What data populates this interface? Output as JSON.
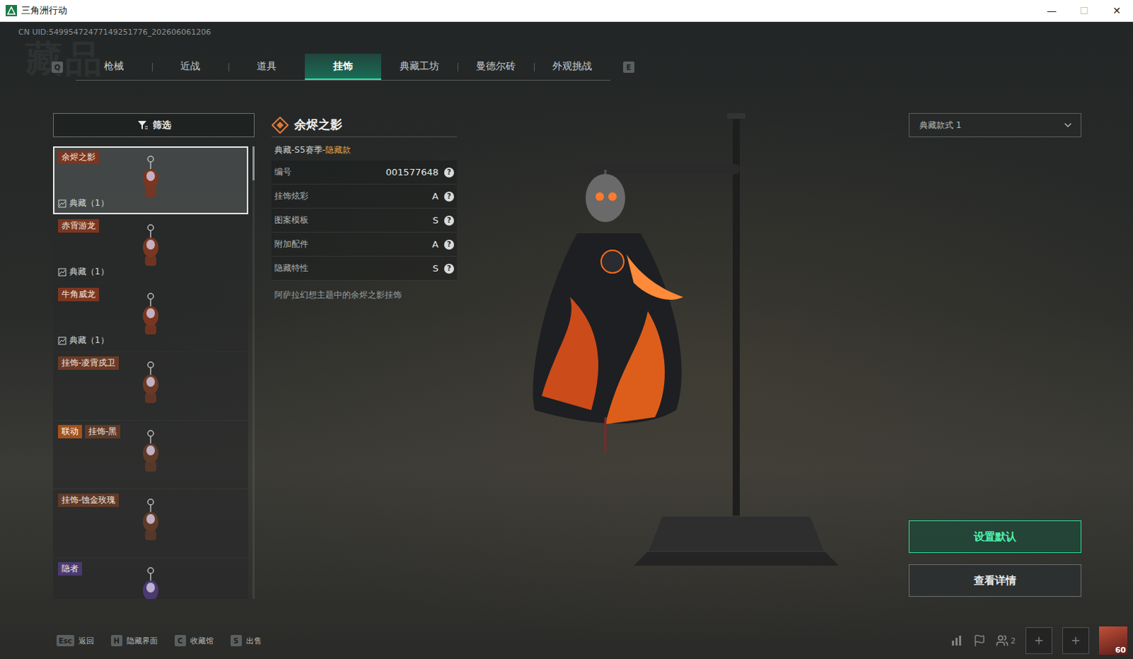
{
  "window": {
    "title": "三角洲行动",
    "controls": [
      "—",
      "☐",
      "✕"
    ]
  },
  "uid": "CN UID:54995472477149251776_202606061206",
  "watermark": "藏品",
  "tabs": {
    "prevKey": "Q",
    "nextKey": "E",
    "items": [
      {
        "label": "枪械",
        "selected": false
      },
      {
        "label": "近战",
        "selected": false
      },
      {
        "label": "道具",
        "selected": false
      },
      {
        "label": "挂饰",
        "selected": true
      },
      {
        "label": "典藏工坊",
        "selected": false
      },
      {
        "label": "曼德尔砖",
        "selected": false
      },
      {
        "label": "外观挑战",
        "selected": false
      }
    ]
  },
  "filter": {
    "label": "筛选"
  },
  "list": {
    "items": [
      {
        "name": "余烬之影",
        "count": "典藏（1）",
        "selected": true,
        "color": "#7a3620"
      },
      {
        "name": "赤霄游龙",
        "count": "典藏（1）",
        "selected": false,
        "color": "#7a3620"
      },
      {
        "name": "牛角威龙",
        "count": "典藏（1）",
        "selected": false,
        "color": "#7a3620"
      },
      {
        "name": "挂饰-凌霄戍卫",
        "selected": false,
        "color": "#6a3a26"
      },
      {
        "name": "挂饰-黑",
        "tag": "联动",
        "selected": false,
        "color": "#5e3a28"
      },
      {
        "name": "挂饰-蚀金玫瑰",
        "selected": false,
        "color": "#5e3a28"
      },
      {
        "name": "隐者",
        "selected": false,
        "color": "#4a3a70"
      }
    ]
  },
  "detail": {
    "title": "余烬之影",
    "category": "典藏-S5赛季-",
    "variant": "隐藏款",
    "rows": [
      {
        "label": "编号",
        "value": "001577648",
        "help": "?"
      },
      {
        "label": "挂饰炫彩",
        "value": "A",
        "help": "?"
      },
      {
        "label": "图案模板",
        "value": "S",
        "help": "?"
      },
      {
        "label": "附加配件",
        "value": "A",
        "help": "?"
      },
      {
        "label": "隐藏特性",
        "value": "S",
        "help": "?"
      }
    ],
    "description": "阿萨拉幻想主题中的余烬之影挂饰"
  },
  "styleSelect": {
    "value": "典藏款式 1"
  },
  "buttons": [
    {
      "label": "设置默认",
      "primary": true
    },
    {
      "label": "查看详情",
      "primary": false
    }
  ],
  "hints": [
    {
      "key": "Esc",
      "label": "返回"
    },
    {
      "key": "H",
      "label": "隐藏界面"
    },
    {
      "key": "C",
      "label": "收藏馆"
    },
    {
      "key": "S",
      "label": "出售"
    }
  ],
  "status": {
    "friends": "2",
    "level": "60"
  }
}
